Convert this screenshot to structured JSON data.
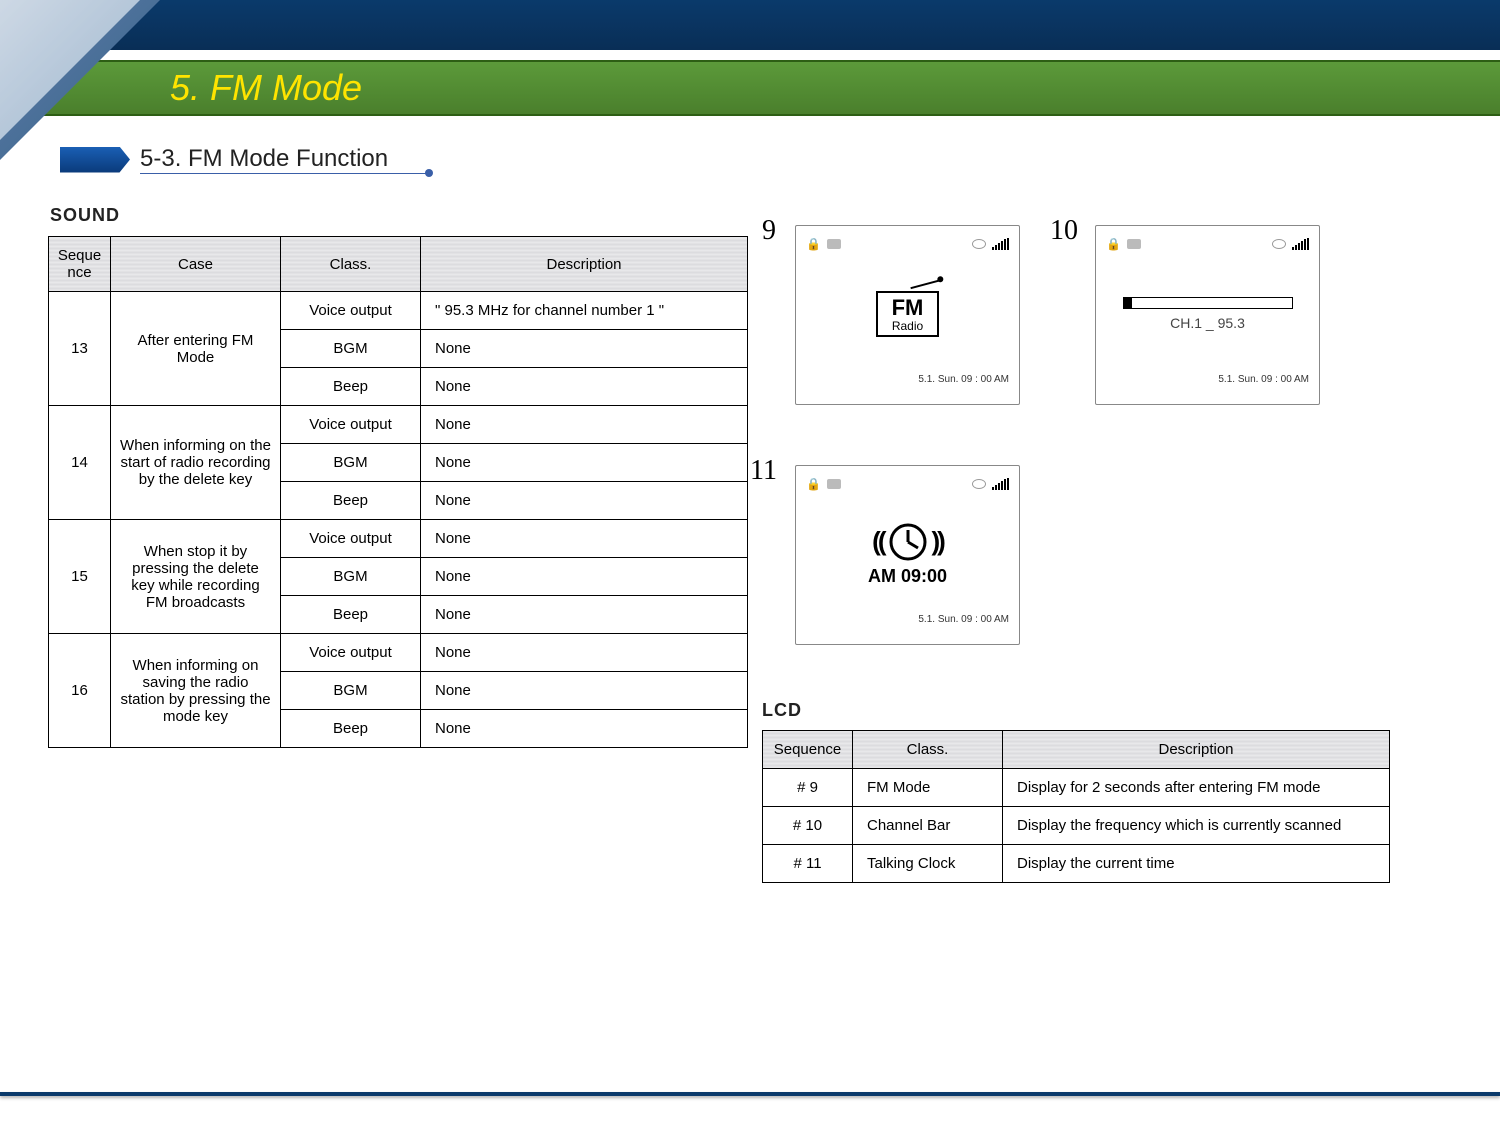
{
  "header": {
    "title": "5. FM Mode",
    "subtitle": "5-3. FM Mode Function"
  },
  "sound": {
    "label": "SOUND",
    "columns": [
      "Sequence",
      "Case",
      "Class.",
      "Description"
    ],
    "rows": [
      {
        "seq": "13",
        "case": "After entering FM Mode",
        "items": [
          {
            "class": "Voice output",
            "desc": "\" 95.3 MHz for channel number 1 \""
          },
          {
            "class": "BGM",
            "desc": "None"
          },
          {
            "class": "Beep",
            "desc": "None"
          }
        ]
      },
      {
        "seq": "14",
        "case": "When informing on the start of radio recording by the delete key",
        "items": [
          {
            "class": "Voice output",
            "desc": "None"
          },
          {
            "class": "BGM",
            "desc": "None"
          },
          {
            "class": "Beep",
            "desc": "None"
          }
        ]
      },
      {
        "seq": "15",
        "case": "When stop it by pressing the delete key while recording FM broadcasts",
        "items": [
          {
            "class": "Voice output",
            "desc": "None"
          },
          {
            "class": "BGM",
            "desc": "None"
          },
          {
            "class": "Beep",
            "desc": "None"
          }
        ]
      },
      {
        "seq": "16",
        "case": "When informing on saving the radio station by pressing the mode key",
        "items": [
          {
            "class": "Voice output",
            "desc": "None"
          },
          {
            "class": "BGM",
            "desc": "None"
          },
          {
            "class": "Beep",
            "desc": "None"
          }
        ]
      }
    ]
  },
  "lcd": {
    "label": "LCD",
    "columns": [
      "Sequence",
      "Class.",
      "Description"
    ],
    "rows": [
      {
        "seq": "# 9",
        "class": "FM Mode",
        "desc": "Display for 2 seconds after entering FM mode"
      },
      {
        "seq": "# 10",
        "class": "Channel Bar",
        "desc": "Display the frequency which is currently scanned"
      },
      {
        "seq": "# 11",
        "class": "Talking Clock",
        "desc": "Display the current time"
      }
    ]
  },
  "shots": {
    "labels": {
      "n9": "9",
      "n10": "10",
      "n11": "11"
    },
    "common_footer": "5.1. Sun. 09 : 00 AM",
    "s9": {
      "title_big": "FM",
      "title_small": "Radio"
    },
    "s10": {
      "channel": "CH.1 _ 95.3"
    },
    "s11": {
      "time": "AM 09:00"
    }
  }
}
